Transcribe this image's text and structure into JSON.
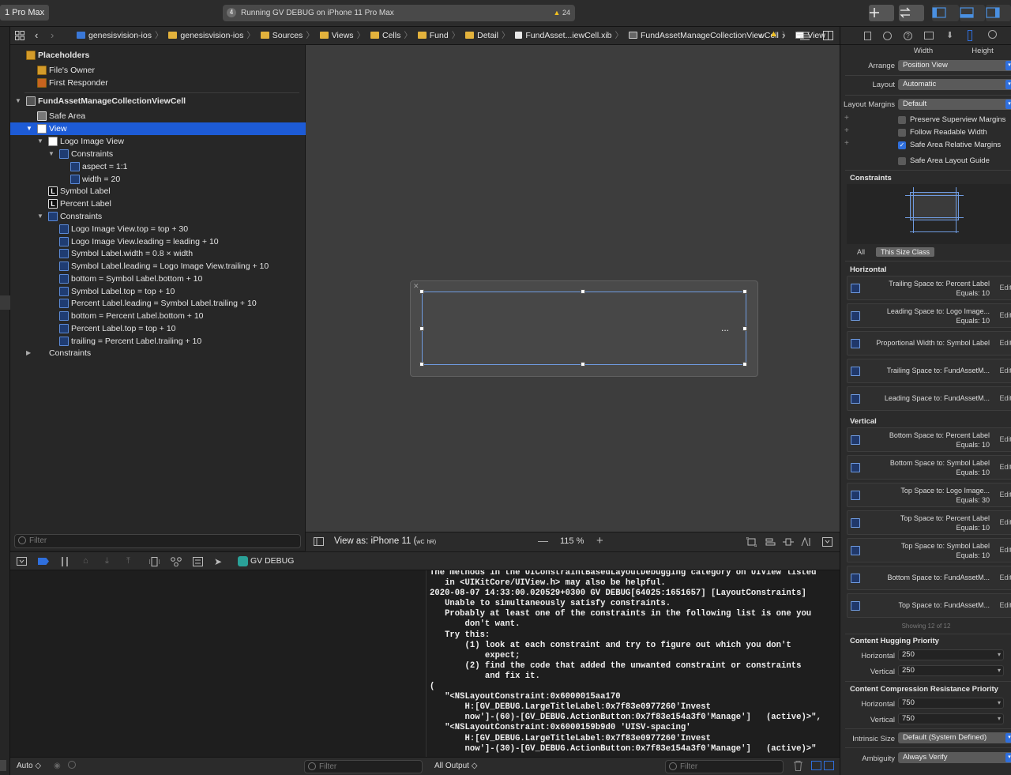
{
  "toolbar": {
    "scheme_destination": "1 Pro Max",
    "activity_status": "Running GV DEBUG on iPhone 11 Pro Max",
    "warning_count": "24",
    "app_badge": "4"
  },
  "jumpbar": {
    "crumbs": [
      "genesisvision-ios",
      "genesisvision-ios",
      "Sources",
      "Views",
      "Cells",
      "Fund",
      "Detail",
      "FundAsset...iewCell.xib",
      "FundAssetManageCollectionViewCell",
      "View"
    ]
  },
  "outline": {
    "rows": [
      {
        "text": "Placeholders",
        "bold": true
      },
      {
        "text": "File's Owner"
      },
      {
        "text": "First Responder"
      },
      {
        "text": "FundAssetManageCollectionViewCell",
        "bold": true
      },
      {
        "text": "Safe Area"
      },
      {
        "text": "View"
      },
      {
        "text": "Logo Image View"
      },
      {
        "text": "Constraints"
      },
      {
        "text": "aspect = 1:1"
      },
      {
        "text": "width = 20"
      },
      {
        "text": "Symbol Label"
      },
      {
        "text": "Percent Label"
      },
      {
        "text": "Constraints"
      },
      {
        "text": "Logo Image View.top = top + 30"
      },
      {
        "text": "Logo Image View.leading = leading + 10"
      },
      {
        "text": "Symbol Label.width = 0.8 × width"
      },
      {
        "text": "Symbol Label.leading = Logo Image View.trailing + 10"
      },
      {
        "text": "bottom = Symbol Label.bottom + 10"
      },
      {
        "text": "Symbol Label.top = top + 10"
      },
      {
        "text": "Percent Label.leading = Symbol Label.trailing + 10"
      },
      {
        "text": "bottom = Percent Label.bottom + 10"
      },
      {
        "text": "Percent Label.top = top + 10"
      },
      {
        "text": "trailing = Percent Label.trailing + 10"
      },
      {
        "text": "Constraints"
      }
    ],
    "filter_placeholder": "Filter"
  },
  "canvas": {
    "view_as": "View as: iPhone 11 (",
    "view_as_wc": "wC",
    "view_as_hr": "hR)",
    "zoom": "115 %",
    "zoom_out": "—",
    "zoom_in": "+",
    "ellipsis": "..."
  },
  "debug": {
    "target": "GV DEBUG",
    "console_text": "The methods in the UIConstraintBasedLayoutDebugging category on UIView listed\n   in <UIKitCore/UIView.h> may also be helpful.\n2020-08-07 14:33:00.020529+0300 GV DEBUG[64025:1651657] [LayoutConstraints]\n   Unable to simultaneously satisfy constraints.\n   Probably at least one of the constraints in the following list is one you\n       don't want.\n   Try this:\n       (1) look at each constraint and try to figure out which you don't\n           expect;\n       (2) find the code that added the unwanted constraint or constraints\n           and fix it.\n(\n   \"<NSLayoutConstraint:0x6000015aa170\n       H:[GV_DEBUG.LargeTitleLabel:0x7f83e0977260'Invest\n       now']-(60)-[GV_DEBUG.ActionButton:0x7f83e154a3f0'Manage']   (active)>\",\n   \"<NSLayoutConstraint:0x6000159b9d0 'UISV-spacing'\n       H:[GV_DEBUG.LargeTitleLabel:0x7f83e0977260'Invest\n       now']-(30)-[GV_DEBUG.ActionButton:0x7f83e154a3f0'Manage']   (active)>\"",
    "auto_label": "Auto ◇",
    "vars_filter": "Filter",
    "output_label": "All Output ◇",
    "console_filter": "Filter"
  },
  "inspector": {
    "width_label": "Width",
    "height_label": "Height",
    "arrange_label": "Arrange",
    "arrange_value": "Position View",
    "layout_label": "Layout",
    "layout_value": "Automatic",
    "margins_label": "Layout Margins",
    "margins_value": "Default",
    "options": [
      {
        "label": "Preserve Superview Margins",
        "checked": false
      },
      {
        "label": "Follow Readable Width",
        "checked": false
      },
      {
        "label": "Safe Area Relative Margins",
        "checked": true
      },
      {
        "label": "Safe Area Layout Guide",
        "checked": false
      }
    ],
    "constraints_header": "Constraints",
    "all_tab": "All",
    "size_class_tab": "This Size Class",
    "horizontal_header": "Horizontal",
    "vertical_header": "Vertical",
    "edit_label": "Edit",
    "horizontal": [
      {
        "line1": "Trailing Space to:  Percent Label",
        "line2": "Equals:  10"
      },
      {
        "line1": "Leading Space to:  Logo Image...",
        "line2": "Equals:  10"
      },
      {
        "line1": "Proportional Width to: Symbol Label",
        "line2": ""
      },
      {
        "line1": "Trailing Space to:  FundAssetM...",
        "line2": ""
      },
      {
        "line1": "Leading Space to:  FundAssetM...",
        "line2": ""
      }
    ],
    "vertical": [
      {
        "line1": "Bottom Space to:  Percent Label",
        "line2": "Equals:  10"
      },
      {
        "line1": "Bottom Space to:  Symbol Label",
        "line2": "Equals:  10"
      },
      {
        "line1": "Top Space to:  Logo Image...",
        "line2": "Equals:  30"
      },
      {
        "line1": "Top Space to:  Percent Label",
        "line2": "Equals:  10"
      },
      {
        "line1": "Top Space to:  Symbol Label",
        "line2": "Equals:  10"
      },
      {
        "line1": "Bottom Space to:  FundAssetM...",
        "line2": ""
      },
      {
        "line1": "Top Space to:  FundAssetM...",
        "line2": ""
      }
    ],
    "showing": "Showing 12 of 12",
    "hugging_header": "Content Hugging Priority",
    "hug_h_label": "Horizontal",
    "hug_h": "250",
    "hug_v_label": "Vertical",
    "hug_v": "250",
    "compression_header": "Content Compression Resistance Priority",
    "comp_h_label": "Horizontal",
    "comp_h": "750",
    "comp_v_label": "Vertical",
    "comp_v": "750",
    "intrinsic_label": "Intrinsic Size",
    "intrinsic_value": "Default (System Defined)",
    "ambiguity_label": "Ambiguity",
    "ambiguity_value": "Always Verify"
  }
}
